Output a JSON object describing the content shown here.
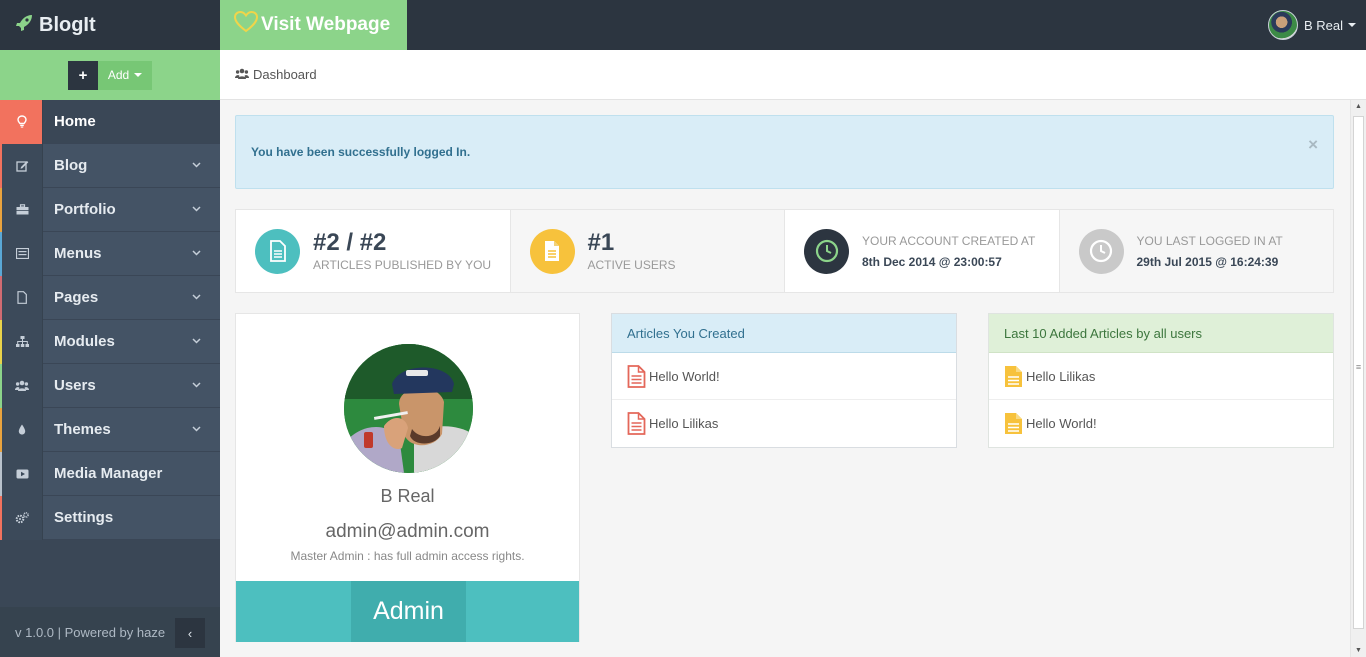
{
  "app": {
    "brand": "BlogIt",
    "visit_label": "Visit Webpage",
    "user_name": "B Real"
  },
  "sidebar": {
    "add_plus": "+",
    "add_label": "Add",
    "items": [
      {
        "label": "Home",
        "icon": "lightbulb-icon"
      },
      {
        "label": "Blog",
        "icon": "edit-icon"
      },
      {
        "label": "Portfolio",
        "icon": "briefcase-icon"
      },
      {
        "label": "Menus",
        "icon": "menu-list-icon"
      },
      {
        "label": "Pages",
        "icon": "page-icon"
      },
      {
        "label": "Modules",
        "icon": "sitemap-icon"
      },
      {
        "label": "Users",
        "icon": "users-icon"
      },
      {
        "label": "Themes",
        "icon": "droplet-icon"
      },
      {
        "label": "Media Manager",
        "icon": "video-icon"
      },
      {
        "label": "Settings",
        "icon": "gears-icon"
      }
    ],
    "footer": "v 1.0.0 | Powered by haze",
    "collapse_glyph": "‹"
  },
  "breadcrumb": {
    "label": "Dashboard"
  },
  "alert": {
    "message": "You have been successfully logged In.",
    "close": "×"
  },
  "stats": [
    {
      "big": "#2 / #2",
      "small": "ARTICLES PUBLISHED BY YOU",
      "icon": "file-icon",
      "color": "#4dbfbf"
    },
    {
      "big": "#1",
      "small": "ACTIVE USERS",
      "icon": "file-icon",
      "color": "#f7c23c"
    },
    {
      "label": "YOUR ACCOUNT CREATED AT",
      "value": "8th Dec 2014 @ 23:00:57",
      "icon": "clock-icon",
      "color": "#2c3540"
    },
    {
      "label": "YOU LAST LOGGED IN AT",
      "value": "29th Jul 2015 @ 16:24:39",
      "icon": "clock-icon",
      "color": "#c9c9c9"
    }
  ],
  "profile": {
    "name": "B Real",
    "email": "admin@admin.com",
    "role_desc": "Master Admin : has full admin access rights.",
    "badge": "Admin"
  },
  "panels": {
    "mine": {
      "title": "Articles You Created",
      "items": [
        "Hello World!",
        "Hello Lilikas"
      ]
    },
    "all": {
      "title": "Last 10 Added Articles by all users",
      "items": [
        "Hello Lilikas",
        "Hello World!"
      ]
    }
  },
  "colors": {
    "accent_green": "#8cd48a",
    "accent_red": "#f2725e",
    "teal": "#4dbfbf",
    "yellow": "#f7c23c",
    "dark": "#2c3540"
  }
}
